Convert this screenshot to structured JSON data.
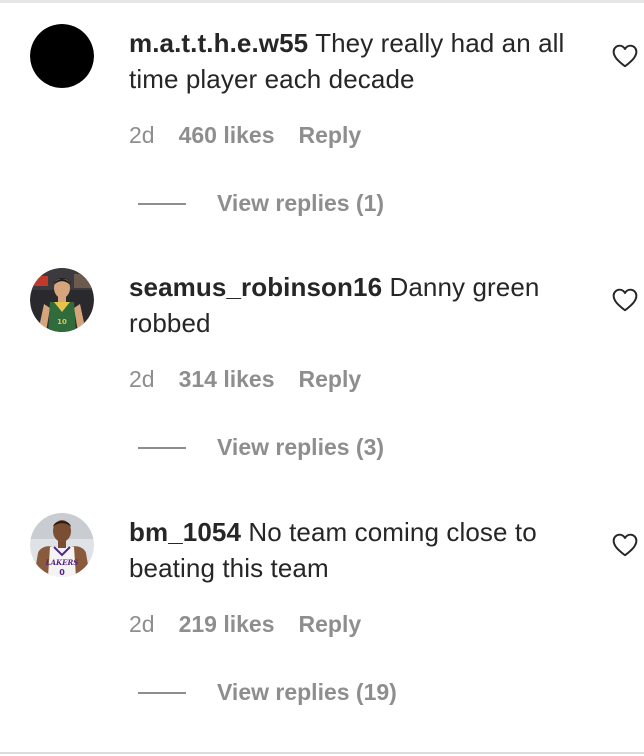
{
  "comments": [
    {
      "username": "m.a.t.t.h.e.w55",
      "text": "They really had an all time player each decade",
      "time": "2d",
      "likes": "460 likes",
      "reply_label": "Reply",
      "view_replies": "View replies (1)",
      "avatar": "black-circle-avatar"
    },
    {
      "username": "seamus_robinson16",
      "text": "Danny green robbed",
      "time": "2d",
      "likes": "314 likes",
      "reply_label": "Reply",
      "view_replies": "View replies (3)",
      "avatar": "basketball-player-green-jersey-avatar"
    },
    {
      "username": "bm_1054",
      "text": "No team coming close to beating this team",
      "time": "2d",
      "likes": "219 likes",
      "reply_label": "Reply",
      "view_replies": "View replies (19)",
      "avatar": "basketball-player-lakers-jersey-avatar"
    }
  ],
  "icons": {
    "like": "heart-outline-icon"
  },
  "colors": {
    "text": "#262626",
    "secondary": "#8e8e8e",
    "background": "#ffffff"
  }
}
